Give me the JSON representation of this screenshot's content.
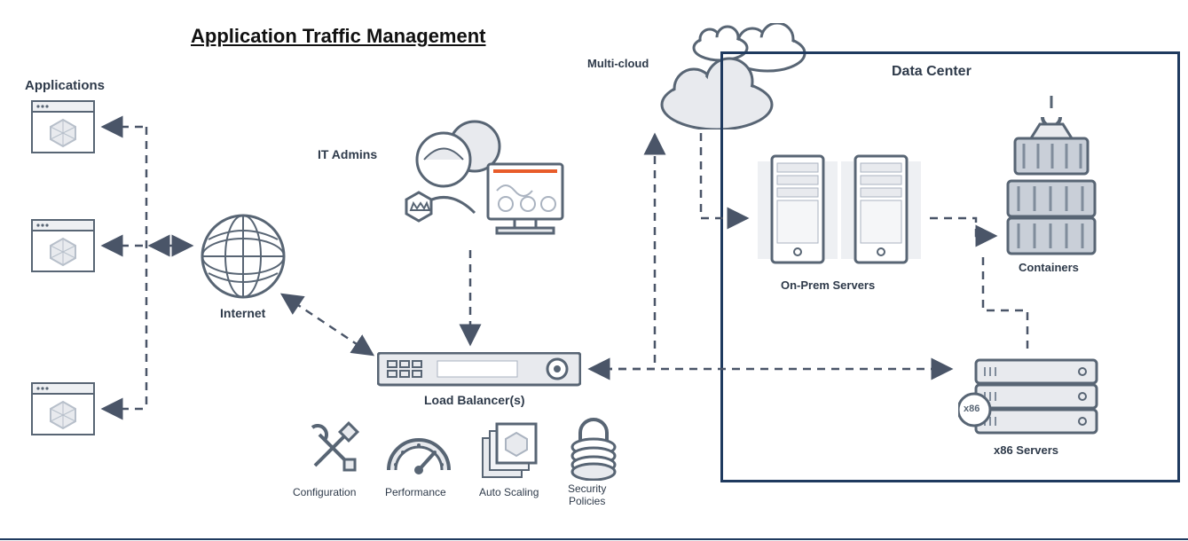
{
  "title": "Application Traffic Management",
  "nodes": {
    "applications": "Applications",
    "internet": "Internet",
    "it_admins": "IT Admins",
    "load_balancer": "Load Balancer(s)",
    "multicloud": "Multi-cloud",
    "data_center": "Data Center",
    "on_prem": "On-Prem Servers",
    "containers": "Containers",
    "x86": "x86 Servers"
  },
  "features": {
    "configuration": "Configuration",
    "performance": "Performance",
    "auto_scaling": "Auto Scaling",
    "security": "Security\nPolicies"
  },
  "badge_x86": "x86"
}
